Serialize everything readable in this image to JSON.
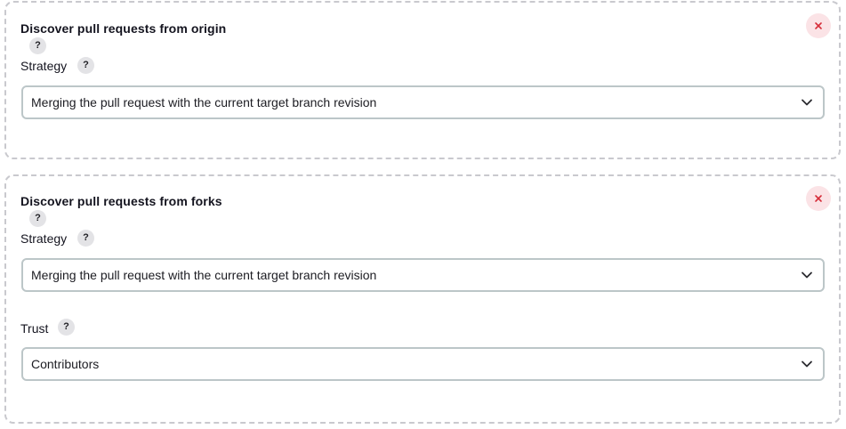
{
  "sections": [
    {
      "title": "Discover pull requests from origin",
      "help_label": "?",
      "close_label": "×",
      "strategy": {
        "label": "Strategy",
        "help_label": "?",
        "value": "Merging the pull request with the current target branch revision"
      }
    },
    {
      "title": "Discover pull requests from forks",
      "help_label": "?",
      "close_label": "×",
      "strategy": {
        "label": "Strategy",
        "help_label": "?",
        "value": "Merging the pull request with the current target branch revision"
      },
      "trust": {
        "label": "Trust",
        "help_label": "?",
        "value": "Contributors"
      }
    }
  ],
  "icons": {
    "help": "question-mark-icon",
    "close": "close-x-icon",
    "dropdown": "chevron-down-icon"
  },
  "colors": {
    "close_bg": "#fbe3e6",
    "close_icon": "#d62e3a",
    "help_bg": "#e3e3e6",
    "card_border": "#c9c9ce",
    "select_border": "#bcc6c8"
  }
}
